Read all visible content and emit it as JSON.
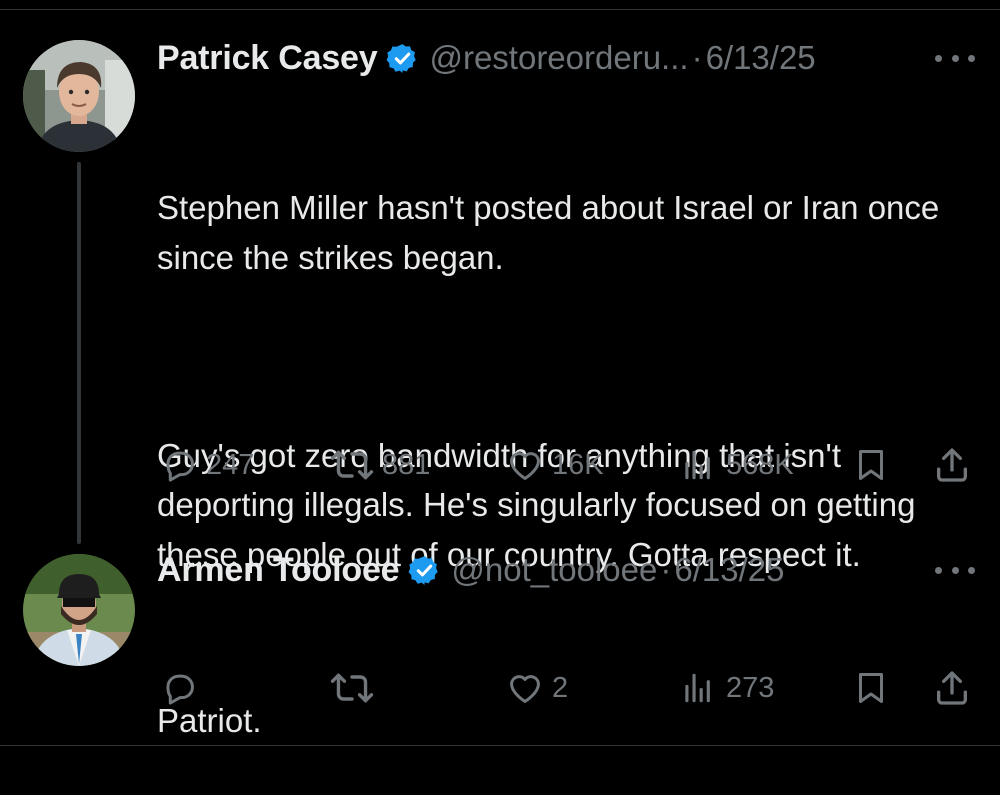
{
  "tweets": [
    {
      "author_name": "Patrick Casey",
      "handle": "@restoreorderu...",
      "separator": "·",
      "date": "6/13/25",
      "avatar": "avatar-patrick",
      "body": [
        "Stephen Miller hasn't posted about Israel or Iran once since the strikes began.",
        "Guy's got zero bandwidth for anything that isn't deporting illegals. He's singularly focused on getting these people out of our country. Gotta respect it."
      ],
      "metrics": {
        "replies": "247",
        "reposts": "881",
        "likes": "16K",
        "views": "568K"
      }
    },
    {
      "author_name": "Armen Tooloee",
      "handle": "@not_tooloee",
      "separator": "·",
      "date": "6/13/25",
      "avatar": "avatar-armen",
      "body": [
        "Patriot."
      ],
      "metrics": {
        "replies": "",
        "reposts": "",
        "likes": "2",
        "views": "273"
      }
    }
  ],
  "colors": {
    "background": "#000000",
    "text": "#e7e9ea",
    "muted": "#71767b",
    "verified": "#1d9bf0",
    "divider": "#2f3336"
  },
  "icons": [
    "verified-badge-icon",
    "more-icon",
    "reply-icon",
    "repost-icon",
    "like-icon",
    "views-icon",
    "bookmark-icon",
    "share-icon"
  ]
}
